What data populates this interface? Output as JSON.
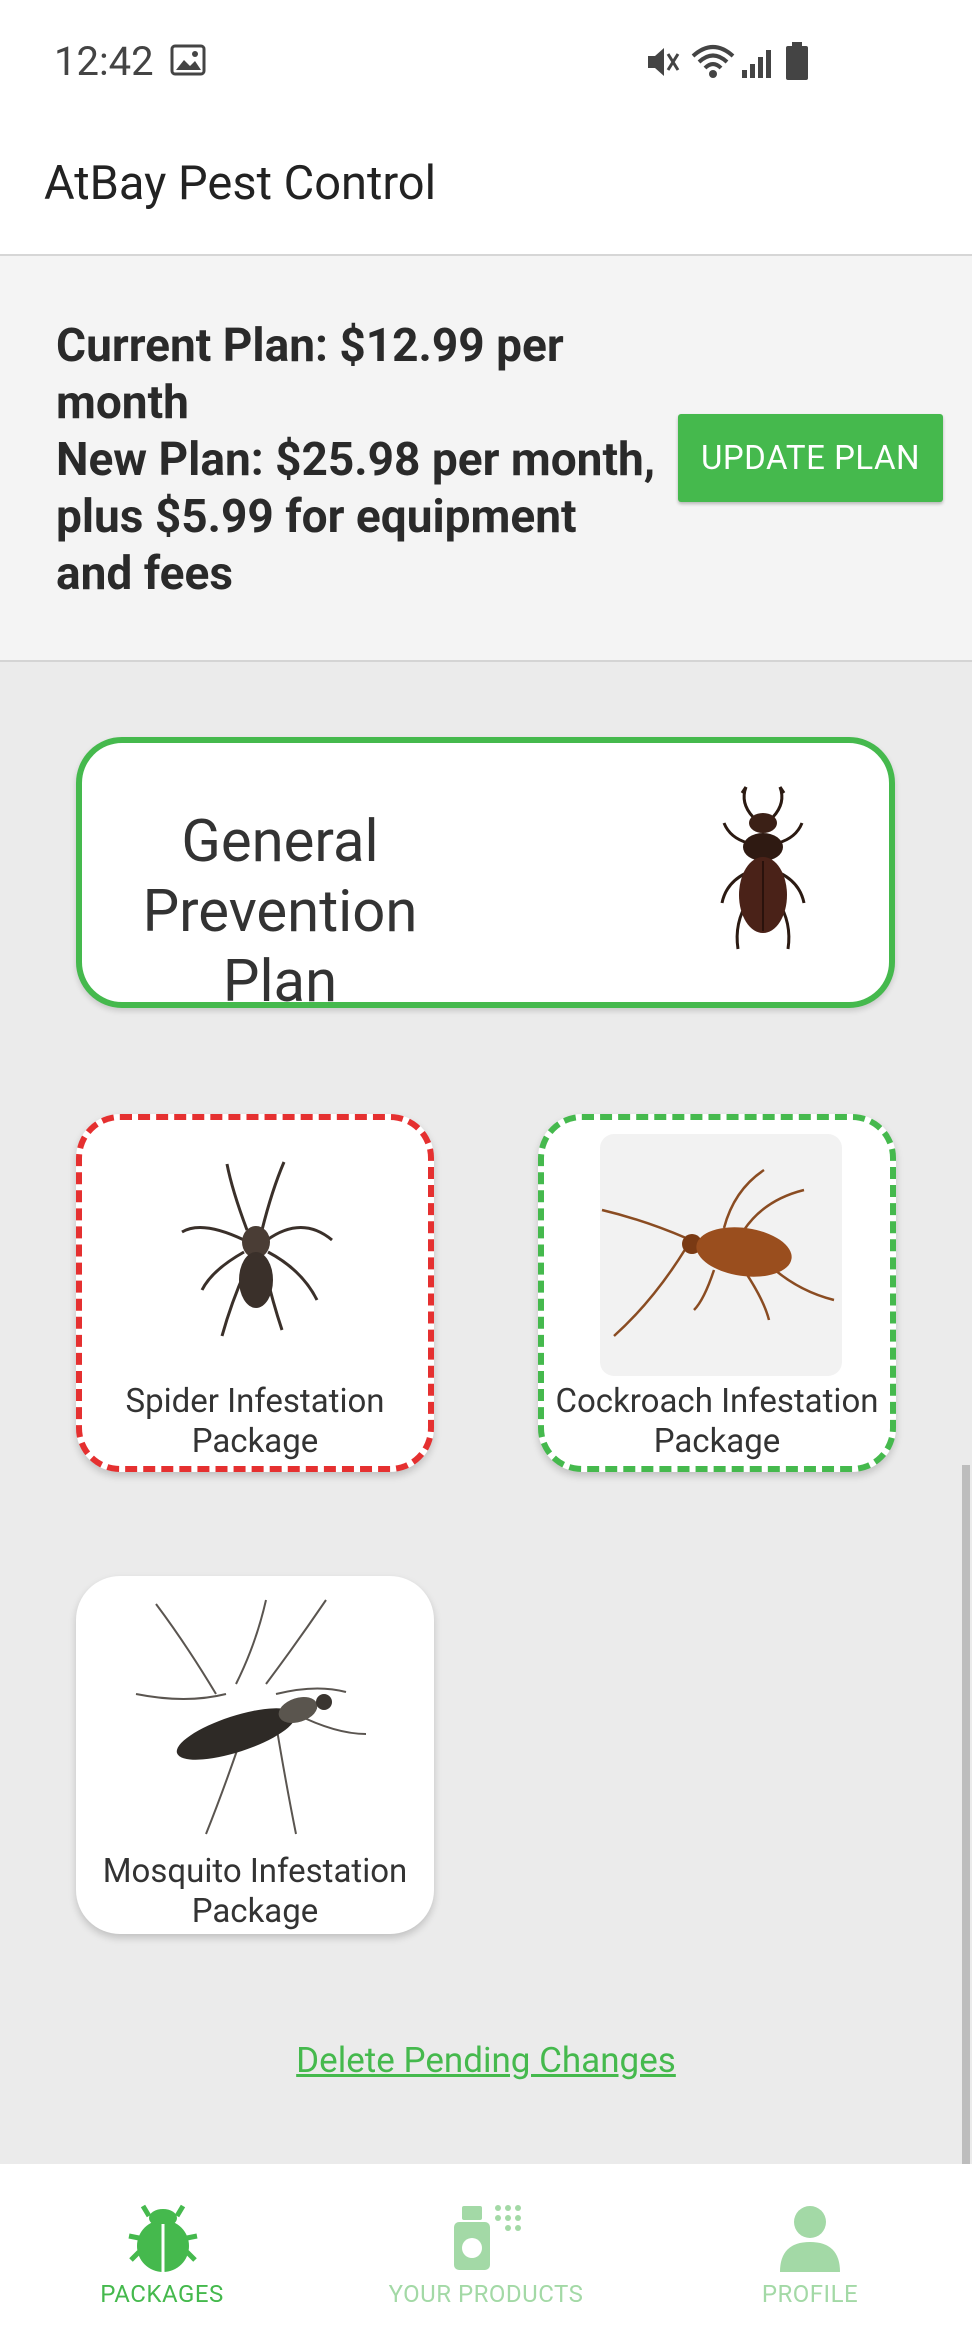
{
  "status": {
    "time": "12:42"
  },
  "app": {
    "title": "AtBay Pest Control"
  },
  "plan": {
    "current": "Current Plan: $12.99 per month",
    "new": "New Plan: $25.98 per month, plus $5.99 for equipment and fees",
    "update_label": "UPDATE PLAN"
  },
  "general_plan": {
    "title": "General Prevention Plan",
    "icon": "beetle-icon"
  },
  "packages": [
    {
      "label": "Spider Infestation Package",
      "status": "removed",
      "border_color": "#e53030"
    },
    {
      "label": "Cockroach Infestation Package",
      "status": "added",
      "border_color": "#45b94d"
    },
    {
      "label": "Mosquito Infestation Package",
      "status": "none"
    }
  ],
  "delete_link": "Delete Pending Changes",
  "nav": [
    {
      "label": "PACKAGES",
      "icon": "bug-icon",
      "active": true
    },
    {
      "label": "YOUR PRODUCTS",
      "icon": "spray-bottle-icon",
      "active": false
    },
    {
      "label": "PROFILE",
      "icon": "person-icon",
      "active": false
    }
  ],
  "colors": {
    "accent": "#45b94d",
    "accent_light": "#a3d9a6",
    "removed": "#e53030"
  }
}
